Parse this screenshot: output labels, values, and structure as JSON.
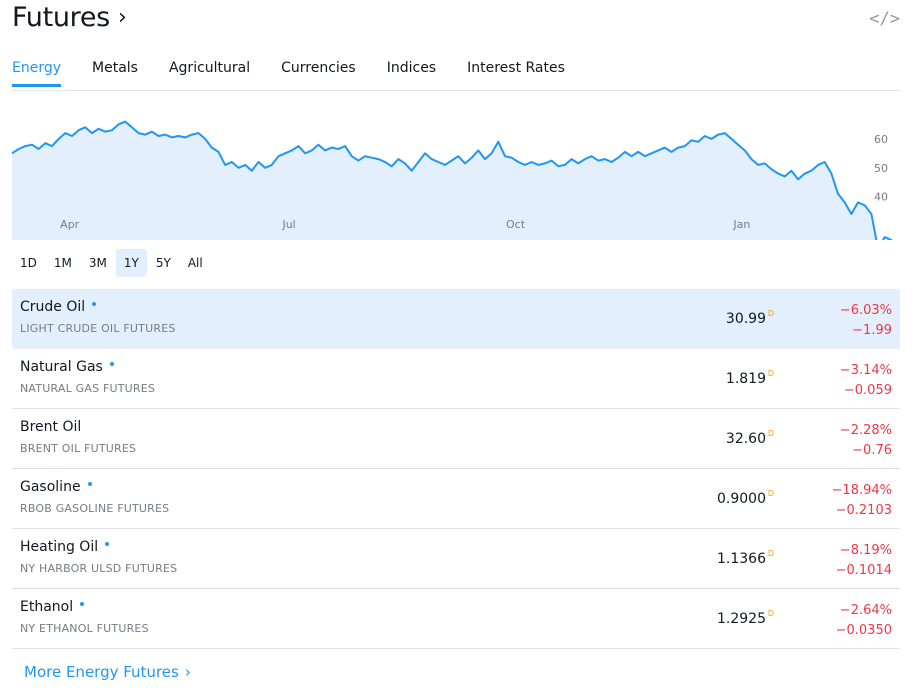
{
  "header": {
    "title": "Futures",
    "title_chevron": "›",
    "embed_icon": "</>"
  },
  "tabs": [
    "Energy",
    "Metals",
    "Agricultural",
    "Currencies",
    "Indices",
    "Interest Rates"
  ],
  "active_tab": 0,
  "chart_data": {
    "type": "area",
    "x_ticks": [
      "Apr",
      "Jul",
      "Oct",
      "Jan"
    ],
    "y_ticks": [
      60,
      50,
      40
    ],
    "ylim": [
      25,
      70
    ],
    "series": [
      {
        "values": [
          55,
          56.5,
          57.5,
          58,
          56.5,
          58.5,
          57.5,
          60,
          62,
          61,
          63,
          64,
          62,
          63.5,
          62.5,
          63,
          65,
          66,
          64,
          62,
          61.5,
          62.5,
          61,
          61.5,
          60.5,
          61,
          60.5,
          61.5,
          62,
          60,
          57,
          55.5,
          51,
          52,
          50,
          51,
          49,
          52,
          50,
          51,
          54,
          55,
          56,
          57.5,
          55,
          56,
          58,
          56,
          57,
          56.5,
          57.5,
          54,
          52.5,
          54,
          53.5,
          53,
          52,
          50.5,
          53,
          51.5,
          49,
          52,
          55,
          53,
          52,
          51,
          52.5,
          54,
          51.5,
          53.5,
          56,
          53,
          55,
          59,
          54,
          53.5,
          52,
          51,
          52,
          51,
          51.5,
          52.5,
          50.5,
          51,
          53,
          51.5,
          53,
          54,
          52.5,
          53,
          52,
          53.5,
          55.5,
          54,
          55.5,
          54,
          55,
          56,
          57,
          55.5,
          57,
          57.5,
          59.5,
          59,
          61,
          60,
          61.5,
          62,
          60,
          58,
          56,
          53,
          51,
          51.5,
          49.5,
          48,
          47,
          49,
          46,
          48,
          49,
          51,
          52,
          48,
          41,
          38,
          34,
          38,
          37,
          34,
          22,
          26,
          25,
          21
        ]
      }
    ]
  },
  "ranges": [
    "1D",
    "1M",
    "3M",
    "1Y",
    "5Y",
    "All"
  ],
  "active_range": 3,
  "rows": [
    {
      "name": "Crude Oil",
      "dot": true,
      "desc": "LIGHT CRUDE OIL FUTURES",
      "price": "30.99",
      "flag": "D",
      "chg_pct": "−6.03%",
      "chg": "−1.99",
      "selected": true
    },
    {
      "name": "Natural Gas",
      "dot": true,
      "desc": "NATURAL GAS FUTURES",
      "price": "1.819",
      "flag": "D",
      "chg_pct": "−3.14%",
      "chg": "−0.059",
      "selected": false
    },
    {
      "name": "Brent Oil",
      "dot": false,
      "desc": "BRENT OIL FUTURES",
      "price": "32.60",
      "flag": "D",
      "chg_pct": "−2.28%",
      "chg": "−0.76",
      "selected": false
    },
    {
      "name": "Gasoline",
      "dot": true,
      "desc": "RBOB GASOLINE FUTURES",
      "price": "0.9000",
      "flag": "D",
      "chg_pct": "−18.94%",
      "chg": "−0.2103",
      "selected": false
    },
    {
      "name": "Heating Oil",
      "dot": true,
      "desc": "NY HARBOR ULSD FUTURES",
      "price": "1.1366",
      "flag": "D",
      "chg_pct": "−8.19%",
      "chg": "−0.1014",
      "selected": false
    },
    {
      "name": "Ethanol",
      "dot": true,
      "desc": "NY ETHANOL FUTURES",
      "price": "1.2925",
      "flag": "D",
      "chg_pct": "−2.64%",
      "chg": "−0.0350",
      "selected": false
    }
  ],
  "more_link": "More Energy Futures",
  "more_chevron": "›",
  "colors": {
    "accent": "#2196f3",
    "negative": "#f23645",
    "area_fill": "#e3effd",
    "flag": "#ff9800"
  }
}
